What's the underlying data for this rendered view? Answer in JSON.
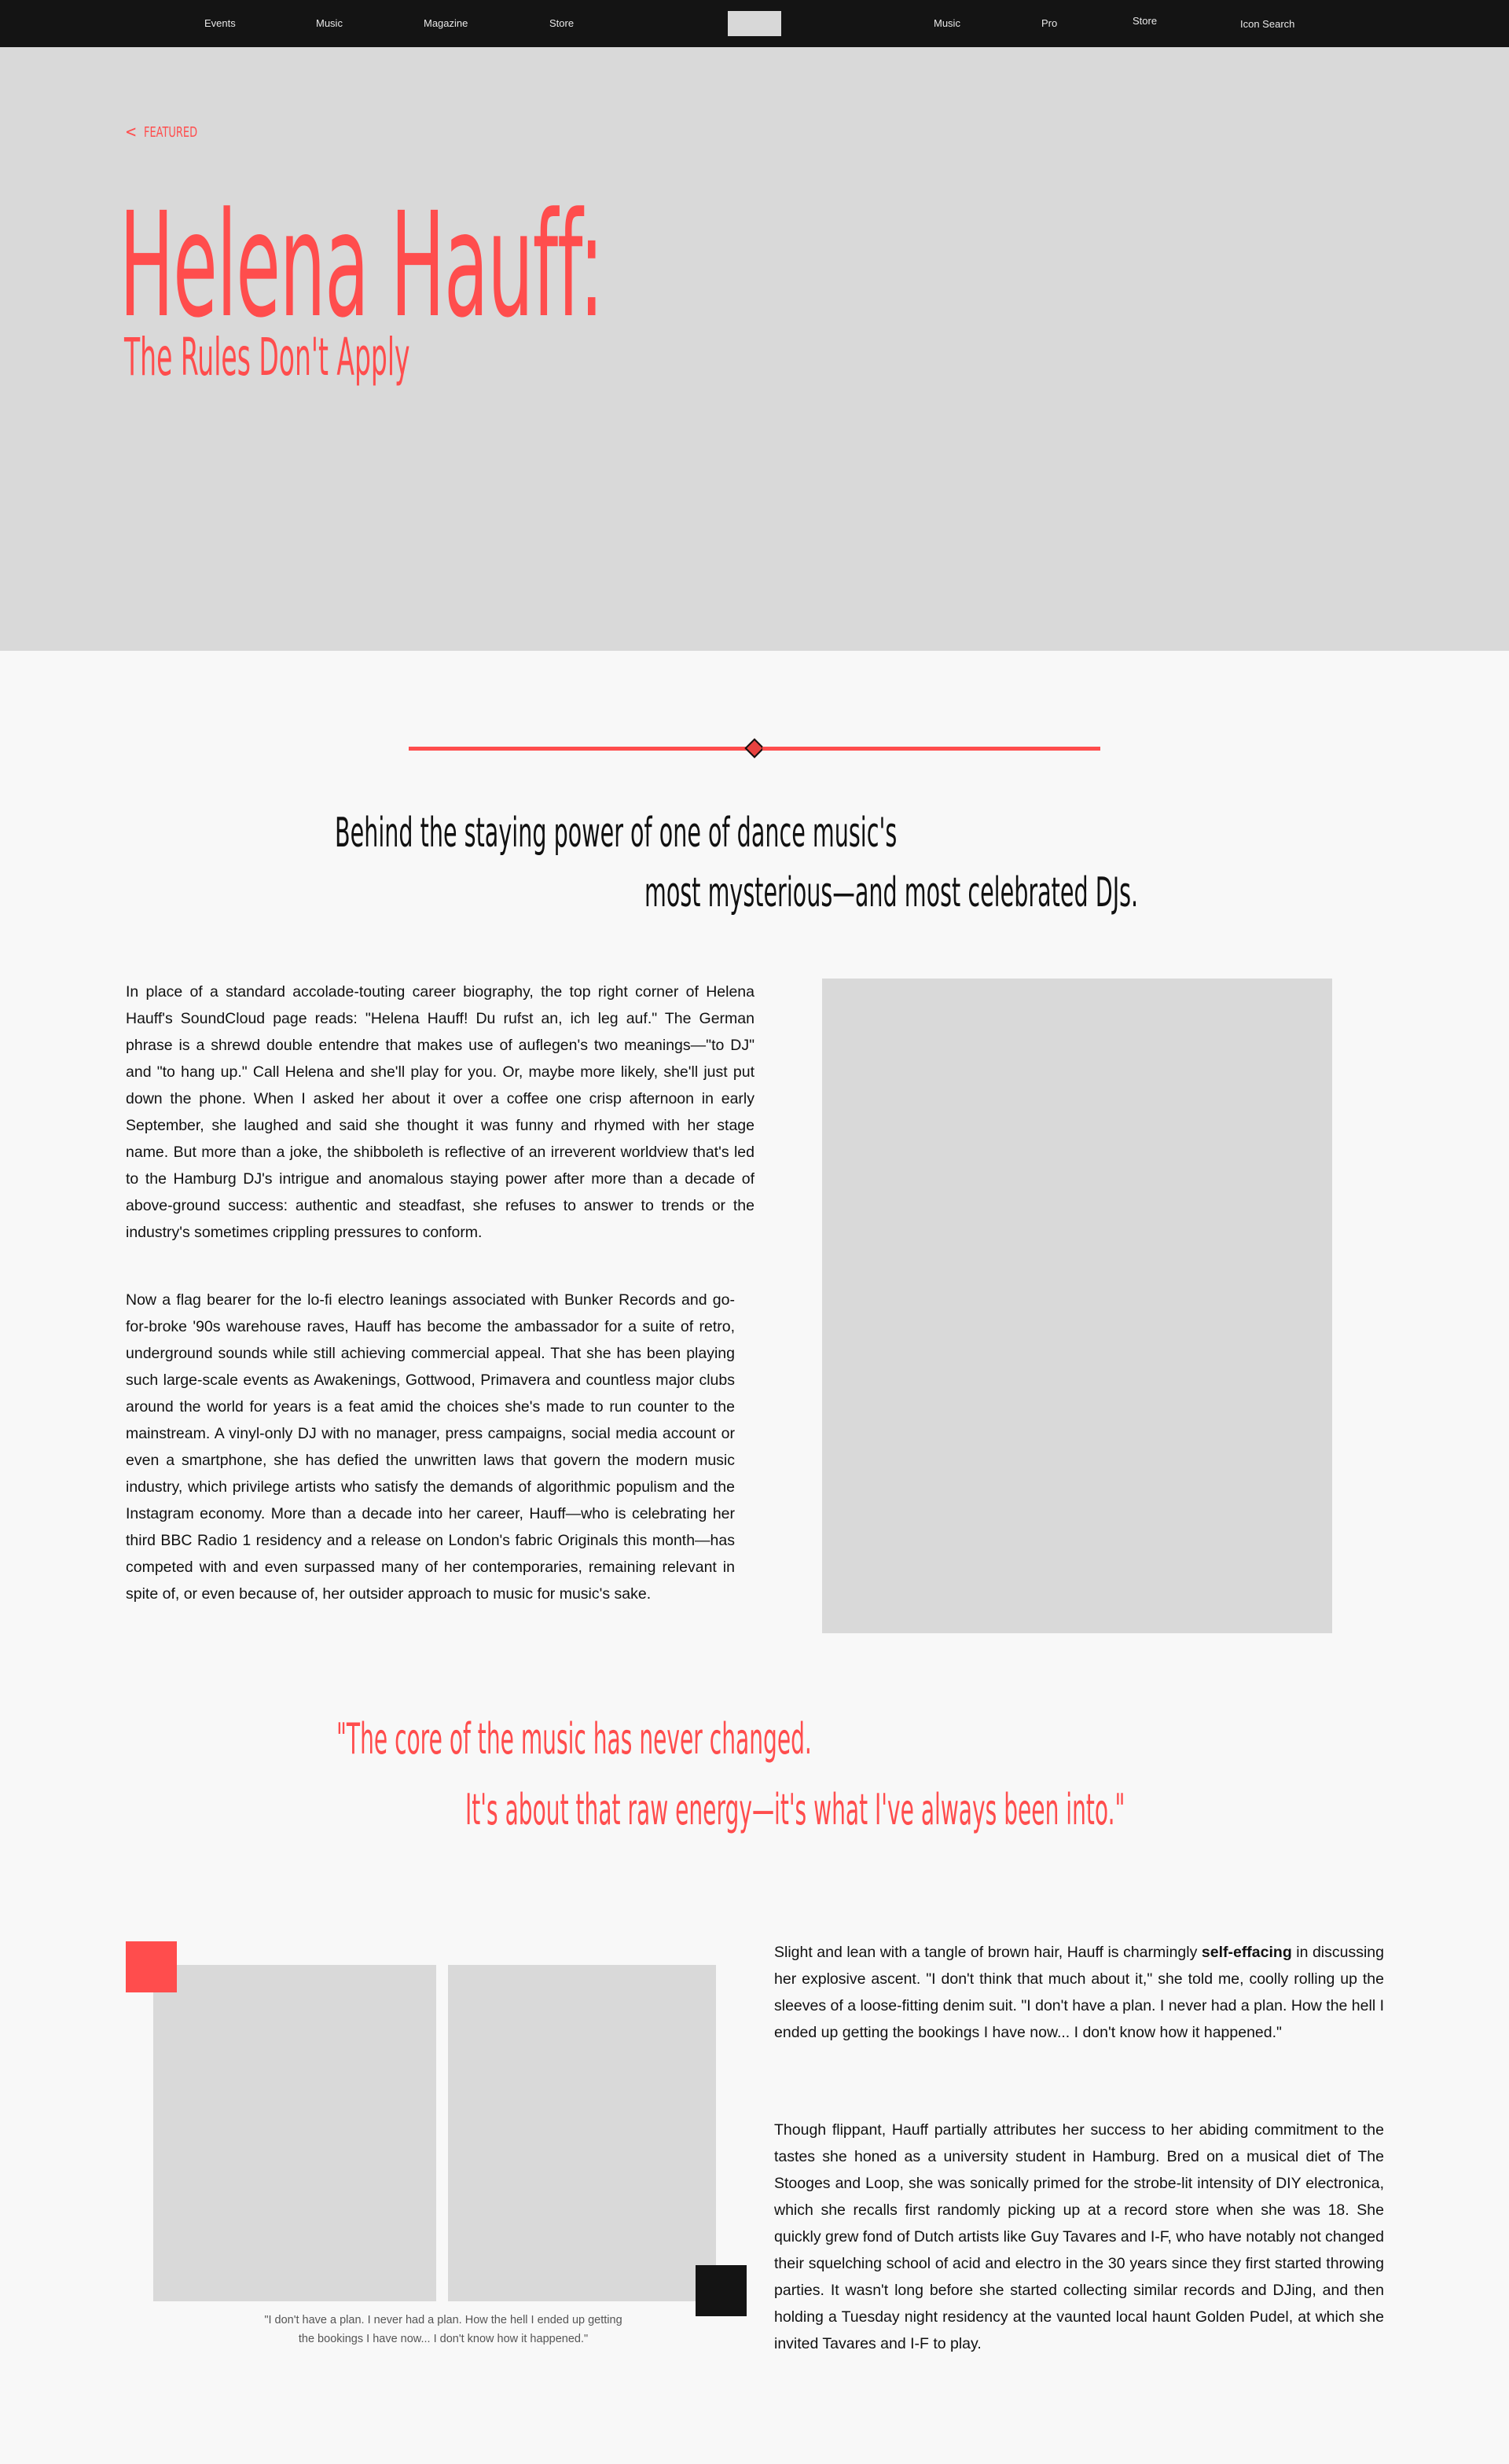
{
  "nav": {
    "left_links": [
      "Events",
      "Music",
      "Magazine",
      "Store"
    ],
    "right_links": [
      "Music",
      "Pro",
      "Store",
      "Icon Search"
    ]
  },
  "hero": {
    "back_label": "FEATURED",
    "title": "Helena Hauff:",
    "subtitle": "The Rules Don't Apply"
  },
  "deck": {
    "line1": "Behind the staying power of one of dance music's",
    "line2": "most mysterious—and most celebrated DJs."
  },
  "article": {
    "p1": "In place of a standard accolade-touting career biography, the top right corner of Helena Hauff's SoundCloud page reads: \"Helena Hauff! Du rufst an, ich leg auf.\" The German phrase is a shrewd double entendre that makes use of auflegen's two meanings—\"to DJ\" and \"to hang up.\" Call Helena and she'll play for you. Or, maybe more likely, she'll just put down the phone. When I asked her about it over a coffee one crisp afternoon in early September, she laughed and said she thought it was funny and rhymed with her stage name. But more than a joke, the shibboleth is reflective of an irreverent worldview that's led to the Hamburg DJ's intrigue and anomalous staying power after more than a decade of above-ground success: authentic and steadfast, she refuses to answer to trends or the industry's sometimes crippling pressures to conform.",
    "p2": "Now a flag bearer for the lo-fi electro leanings associated with Bunker Records and go-for-broke '90s warehouse raves, Hauff has become the ambassador for a suite of retro, underground sounds while still achieving commercial appeal. That she has been playing such large-scale events as Awakenings, Gottwood, Primavera and countless major clubs around the world for years is a feat amid the choices she's made to run counter to the mainstream. A vinyl-only DJ with no manager, press campaigns, social media account or even a smartphone, she has defied the unwritten laws that govern the modern music industry, which privilege artists who satisfy the demands of algorithmic populism and the Instagram economy. More than a decade into her career, Hauff—who is celebrating her third BBC Radio 1 residency and a release on London's fabric Originals this month—has competed with and even surpassed many of her contemporaries, remaining relevant in spite of, or even because of, her outsider approach to music for music's sake.",
    "p3_before": "Slight and lean with a tangle of brown hair, Hauff is charmingly ",
    "p3_bold": "self-effacing",
    "p3_after": " in discussing her explosive ascent. \"I don't think that much about it,\" she told me, coolly rolling up the sleeves of a loose-fitting denim suit. \"I don't have a plan. I never had a plan. How the hell I ended up getting the bookings I have now... I don't know how it happened.\"",
    "p4": "Though flippant, Hauff partially attributes her success to her abiding commitment to the tastes she honed as a university student in Hamburg. Bred on a musical diet of The Stooges and Loop, she was sonically primed for the strobe-lit intensity of DIY electronica, which she recalls first randomly picking up at a record store when she was 18. She quickly grew fond of Dutch artists like Guy Tavares and I-F, who have notably not changed their squelching school of acid and electro in the 30 years since they first started throwing parties. It wasn't long before she started collecting similar records and DJing, and then holding a Tuesday night residency at the vaunted local haunt Golden Pudel, at which she invited Tavares and I-F to play."
  },
  "pull_quote": {
    "line1": "\"The core of the music has never changed.",
    "line2": "It's about that raw energy—it's what I've always been into.\""
  },
  "caption": {
    "line1": "\"I don't have a plan. I never had a plan. How the hell I ended up getting",
    "line2": "the bookings I have now... I don't know how it happened.\""
  },
  "colors": {
    "accent": "#ff4d4d",
    "nav_bg": "#141414",
    "placeholder": "#d9d9d9"
  },
  "icons": {
    "back": "chevron-left-icon",
    "divider": "diamond-icon"
  }
}
